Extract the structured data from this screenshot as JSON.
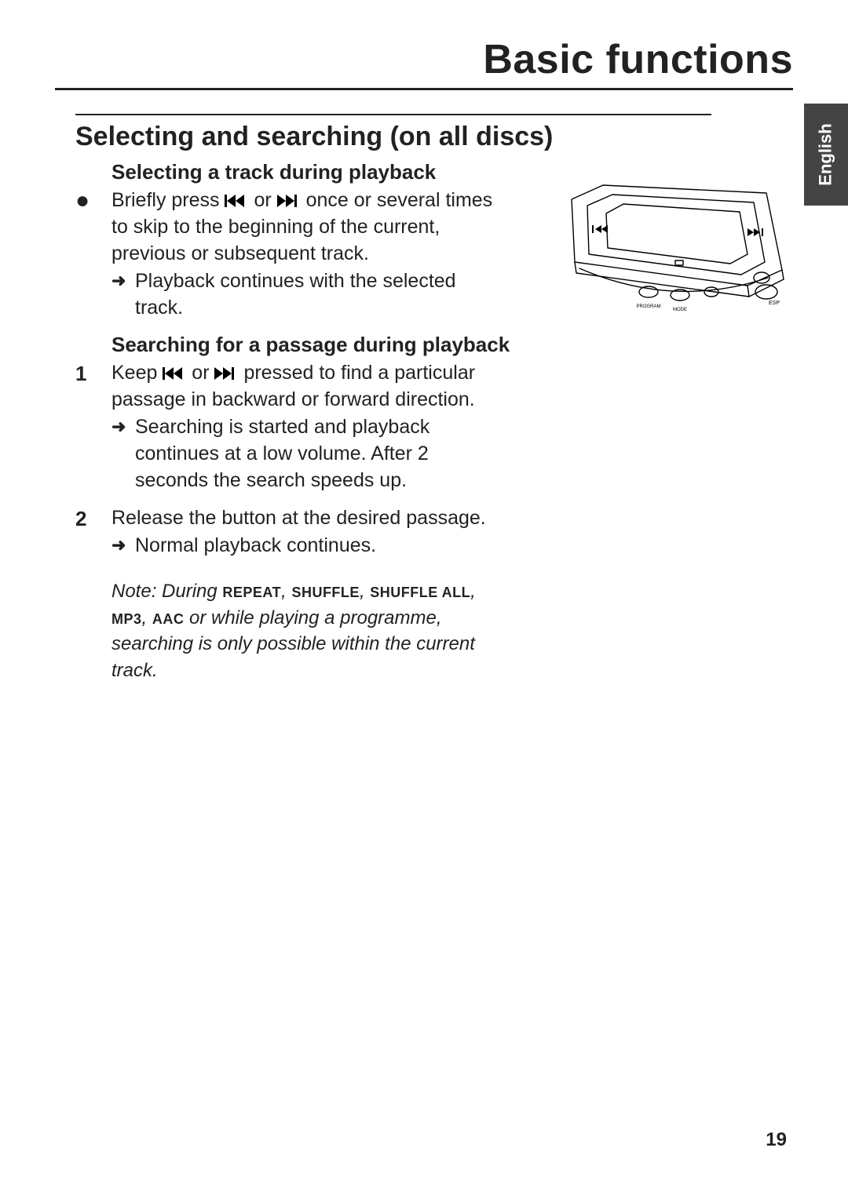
{
  "chapter": "Basic functions",
  "language_tab": "English",
  "section_title": "Selecting and searching (on all discs)",
  "sub1": {
    "heading": "Selecting a track during playback",
    "bullet_text_a": "Briefly press ",
    "bullet_text_b": " or ",
    "bullet_text_c": " once or several times to skip to the beginning of the current, previous or subsequent track.",
    "result": "Playback continues with the selected track."
  },
  "sub2": {
    "heading": "Searching for a passage during playback",
    "step1_a": "Keep ",
    "step1_b": " or ",
    "step1_c": " pressed to find a particular passage in backward or forward direction.",
    "step1_result": "Searching is started and playback continues at a low volume. After 2 seconds the search speeds up.",
    "step2": "Release the button at the desired passage.",
    "step2_result": "Normal playback continues."
  },
  "note": {
    "lead": "Note: During ",
    "modes": [
      "REPEAT",
      "SHUFFLE",
      "SHUFFLE ALL",
      "MP3",
      "AAC"
    ],
    "tail": " or while playing a programme, searching is only possible within the current track."
  },
  "figure_labels": {
    "program": "PROGRAM",
    "mode": "MODE",
    "esp": "ESP"
  },
  "page_number": "19"
}
